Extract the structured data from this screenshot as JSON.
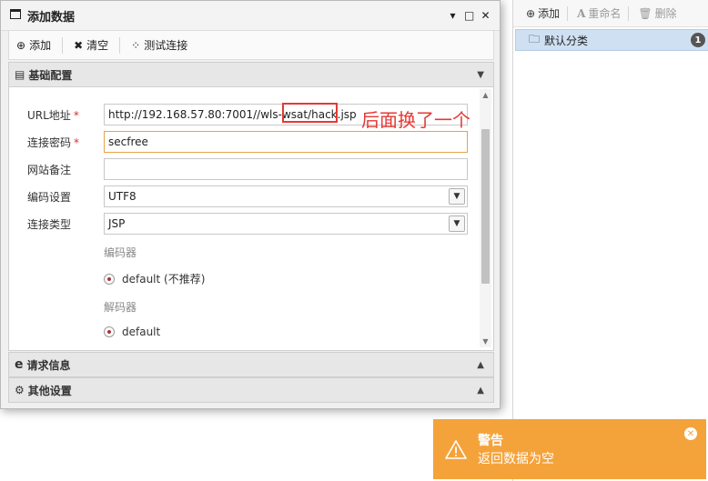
{
  "dialog": {
    "title": "添加数据",
    "controls": {
      "minimize": "▾",
      "maximize": "□",
      "close": "✕"
    },
    "toolbar": {
      "add_label": "添加",
      "clear_label": "清空",
      "test_label": "测试连接"
    }
  },
  "sections": {
    "basic": {
      "title": "基础配置"
    },
    "request": {
      "title": "请求信息"
    },
    "other": {
      "title": "其他设置"
    }
  },
  "form": {
    "url": {
      "label": "URL地址",
      "value": "http://192.168.57.80:7001//wls-wsat/hack.jsp"
    },
    "password": {
      "label": "连接密码",
      "value": "secfree"
    },
    "note": {
      "label": "网站备注",
      "value": ""
    },
    "encoding": {
      "label": "编码设置",
      "value": "UTF8"
    },
    "type": {
      "label": "连接类型",
      "value": "JSP"
    },
    "encoder": {
      "label": "编码器",
      "option": "default (不推荐)"
    },
    "decoder": {
      "label": "解码器",
      "option": "default"
    }
  },
  "annotation": {
    "text": "后面换了一个"
  },
  "right_panel": {
    "add_label": "添加",
    "rename_label": "重命名",
    "delete_label": "删除",
    "category": {
      "label": "默认分类",
      "count": "1"
    }
  },
  "toast": {
    "title": "警告",
    "message": "返回数据为空",
    "color": "#f4a33b"
  },
  "colors": {
    "required": "#d32f2f",
    "annotation": "#e53935",
    "selected_row": "#cfe0f3"
  }
}
